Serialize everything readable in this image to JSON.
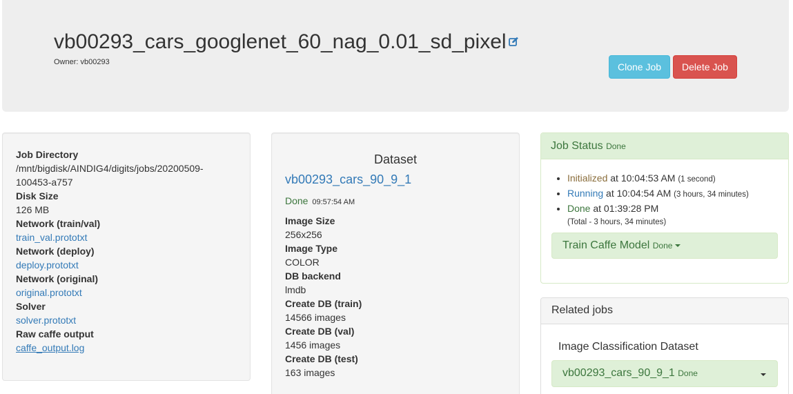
{
  "header": {
    "title": "vb00293_cars_googlenet_60_nag_0.01_sd_pixel",
    "owner": "Owner: vb00293",
    "edit_icon": "edit-icon",
    "clone_label": "Clone Job",
    "delete_label": "Delete Job"
  },
  "job_info": {
    "job_directory_label": "Job Directory",
    "job_directory_value_1": "/mnt/bigdisk/AINDIG4/digits/jobs/20200509-",
    "job_directory_value_2": "100453-a757",
    "disk_size_label": "Disk Size",
    "disk_size_value": "126 MB",
    "network_trainval_label": "Network (train/val)",
    "network_trainval_link": "train_val.prototxt",
    "network_deploy_label": "Network (deploy)",
    "network_deploy_link": "deploy.prototxt",
    "network_original_label": "Network (original)",
    "network_original_link": "original.prototxt",
    "solver_label": "Solver",
    "solver_link": "solver.prototxt",
    "raw_output_label": "Raw caffe output",
    "raw_output_link": "caffe_output.log"
  },
  "dataset": {
    "heading": "Dataset",
    "name": "vb00293_cars_90_9_1",
    "status": "Done",
    "status_time": "09:57:54 AM",
    "image_size_label": "Image Size",
    "image_size_value": "256x256",
    "image_type_label": "Image Type",
    "image_type_value": "COLOR",
    "db_backend_label": "DB backend",
    "db_backend_value": "lmdb",
    "create_train_label": "Create DB (train)",
    "create_train_value": "14566 images",
    "create_val_label": "Create DB (val)",
    "create_val_value": "1456 images",
    "create_test_label": "Create DB (test)",
    "create_test_value": "163 images"
  },
  "job_status": {
    "title": "Job Status",
    "title_status": "Done",
    "items": [
      {
        "state": "Initialized",
        "at": "at 10:04:53 AM",
        "duration": "(1 second)"
      },
      {
        "state": "Running",
        "at": "at 10:04:54 AM",
        "duration": "(3 hours, 34 minutes)"
      },
      {
        "state": "Done",
        "at": "at 01:39:28 PM",
        "duration": ""
      }
    ],
    "total": "(Total - 3 hours, 34 minutes)",
    "train_task_label": "Train Caffe Model",
    "train_task_status": "Done"
  },
  "related_jobs": {
    "title": "Related jobs",
    "subheading": "Image Classification Dataset",
    "job_name": "vb00293_cars_90_9_1",
    "job_status": "Done"
  },
  "colors": {
    "info_button": "#5bc0de",
    "danger_button": "#d9534f",
    "success_text": "#3c763d",
    "success_bg": "#dff0d8",
    "link": "#337ab7"
  }
}
